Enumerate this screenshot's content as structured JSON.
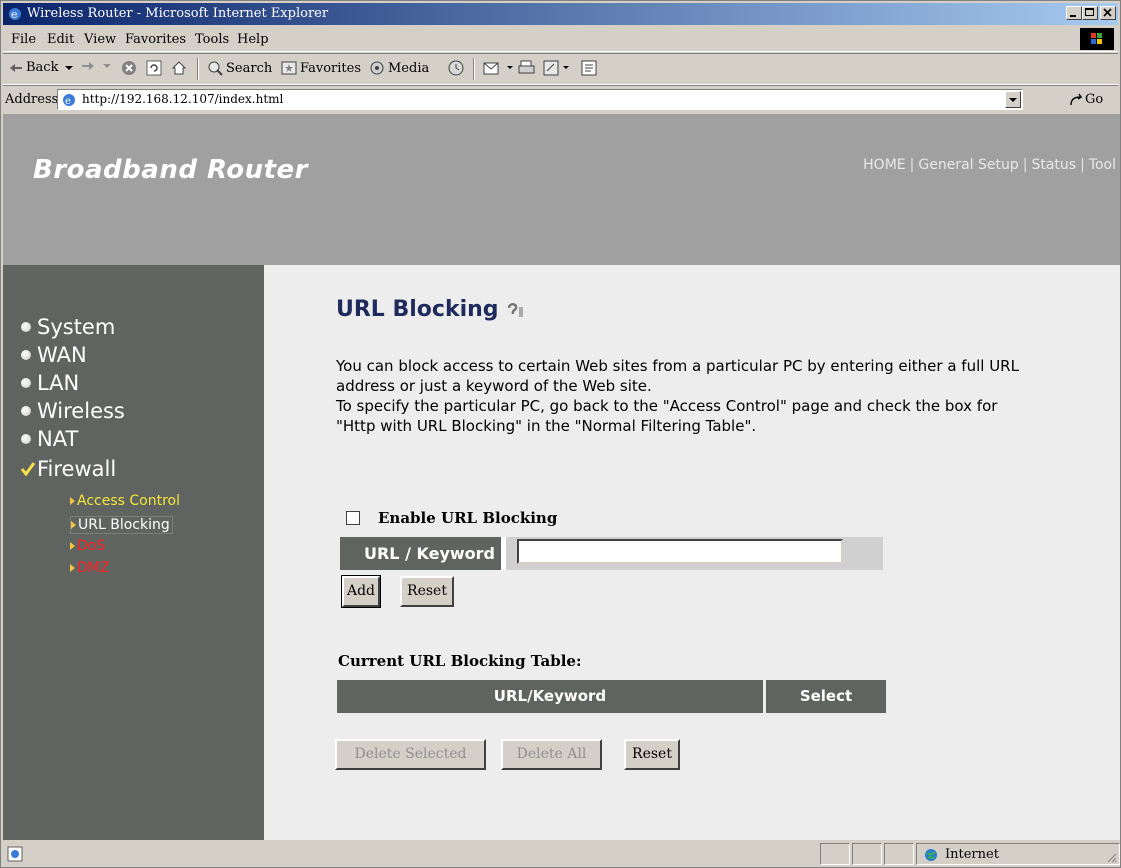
{
  "window": {
    "title": "Wireless Router - Microsoft Internet Explorer"
  },
  "menubar": {
    "file": "File",
    "edit": "Edit",
    "view": "View",
    "favorites": "Favorites",
    "tools": "Tools",
    "help": "Help"
  },
  "toolbar": {
    "back": "Back",
    "search": "Search",
    "favorites": "Favorites",
    "media": "Media"
  },
  "address": {
    "label": "Address",
    "url": "http://192.168.12.107/index.html",
    "go": "Go"
  },
  "router": {
    "brand": "Broadband Router",
    "topnav": [
      "HOME",
      "General Setup",
      "Status",
      "Tool"
    ]
  },
  "sidebar": {
    "items": [
      "System",
      "WAN",
      "LAN",
      "Wireless",
      "NAT",
      "Firewall"
    ],
    "firewall_sub": [
      {
        "label": "Access Control",
        "color": "#f5e63c"
      },
      {
        "label": "URL Blocking",
        "color": "#ffffff"
      },
      {
        "label": "DoS",
        "color": "#ff2020"
      },
      {
        "label": "DMZ",
        "color": "#ff2020"
      }
    ]
  },
  "page": {
    "title": "URL Blocking",
    "desc1": "You can block access to certain Web sites from a particular PC by entering either a full URL address or just a keyword of the Web site.",
    "desc2": "To specify the particular PC, go back to the \"Access Control\" page and check the box for \"Http with URL Blocking\" in the \"Normal Filtering Table\".",
    "enable_label": "Enable URL Blocking",
    "enable_checked": false,
    "keyword_label": "URL / Keyword",
    "keyword_value": "",
    "add_button": "Add",
    "reset_button": "Reset",
    "table_title": "Current URL Blocking Table:",
    "col_keyword": "URL/Keyword",
    "col_select": "Select",
    "delete_selected": "Delete Selected",
    "delete_all": "Delete All",
    "reset_button2": "Reset"
  },
  "statusbar": {
    "zone": "Internet"
  },
  "colors": {
    "header_bg": "#a0a0a0",
    "sidebar_bg": "#5f6460",
    "title_color": "#1e2b5c",
    "titlebar_start": "#0a246a"
  }
}
